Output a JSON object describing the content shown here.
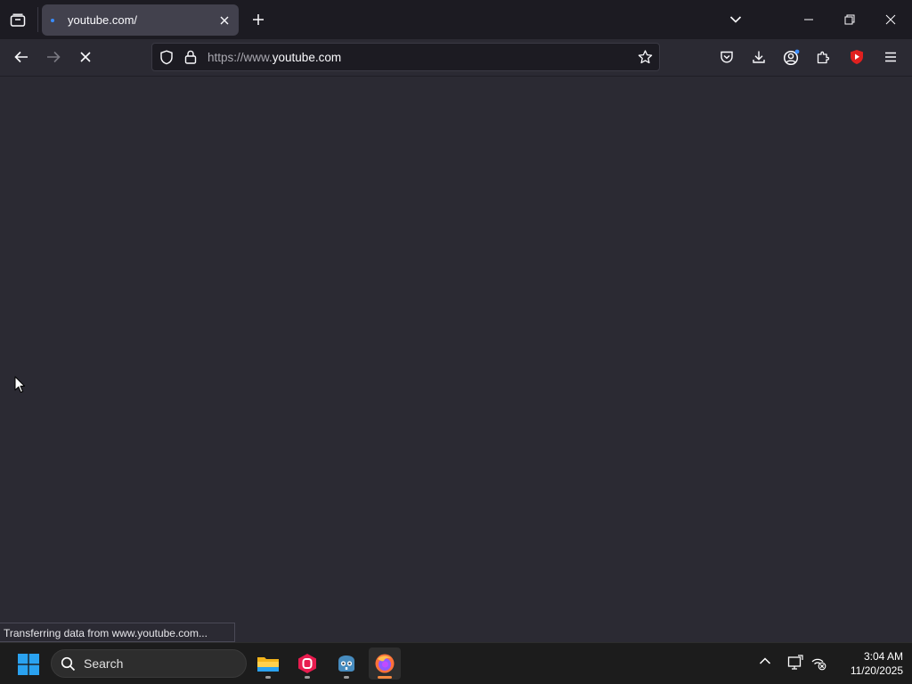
{
  "tabs": [
    {
      "title": "youtube.com/",
      "active": true
    }
  ],
  "navbar": {
    "url_prefix": "https://www.",
    "url_host": "youtube.com"
  },
  "status_text": "Transferring data from www.youtube.com...",
  "taskbar": {
    "search_label": "Search",
    "apps": [
      "file-explorer",
      "app-d",
      "godot-engine",
      "firefox"
    ],
    "clock_time": "3:04 AM",
    "clock_date": "11/20/2025"
  },
  "colors": {
    "page_bg": "#2b2a33",
    "tabstrip_bg": "#1c1b22",
    "active_tab_bg": "#42414d",
    "accent_blue": "#3a8cff",
    "taskbar_bg": "#1c1c1c"
  }
}
